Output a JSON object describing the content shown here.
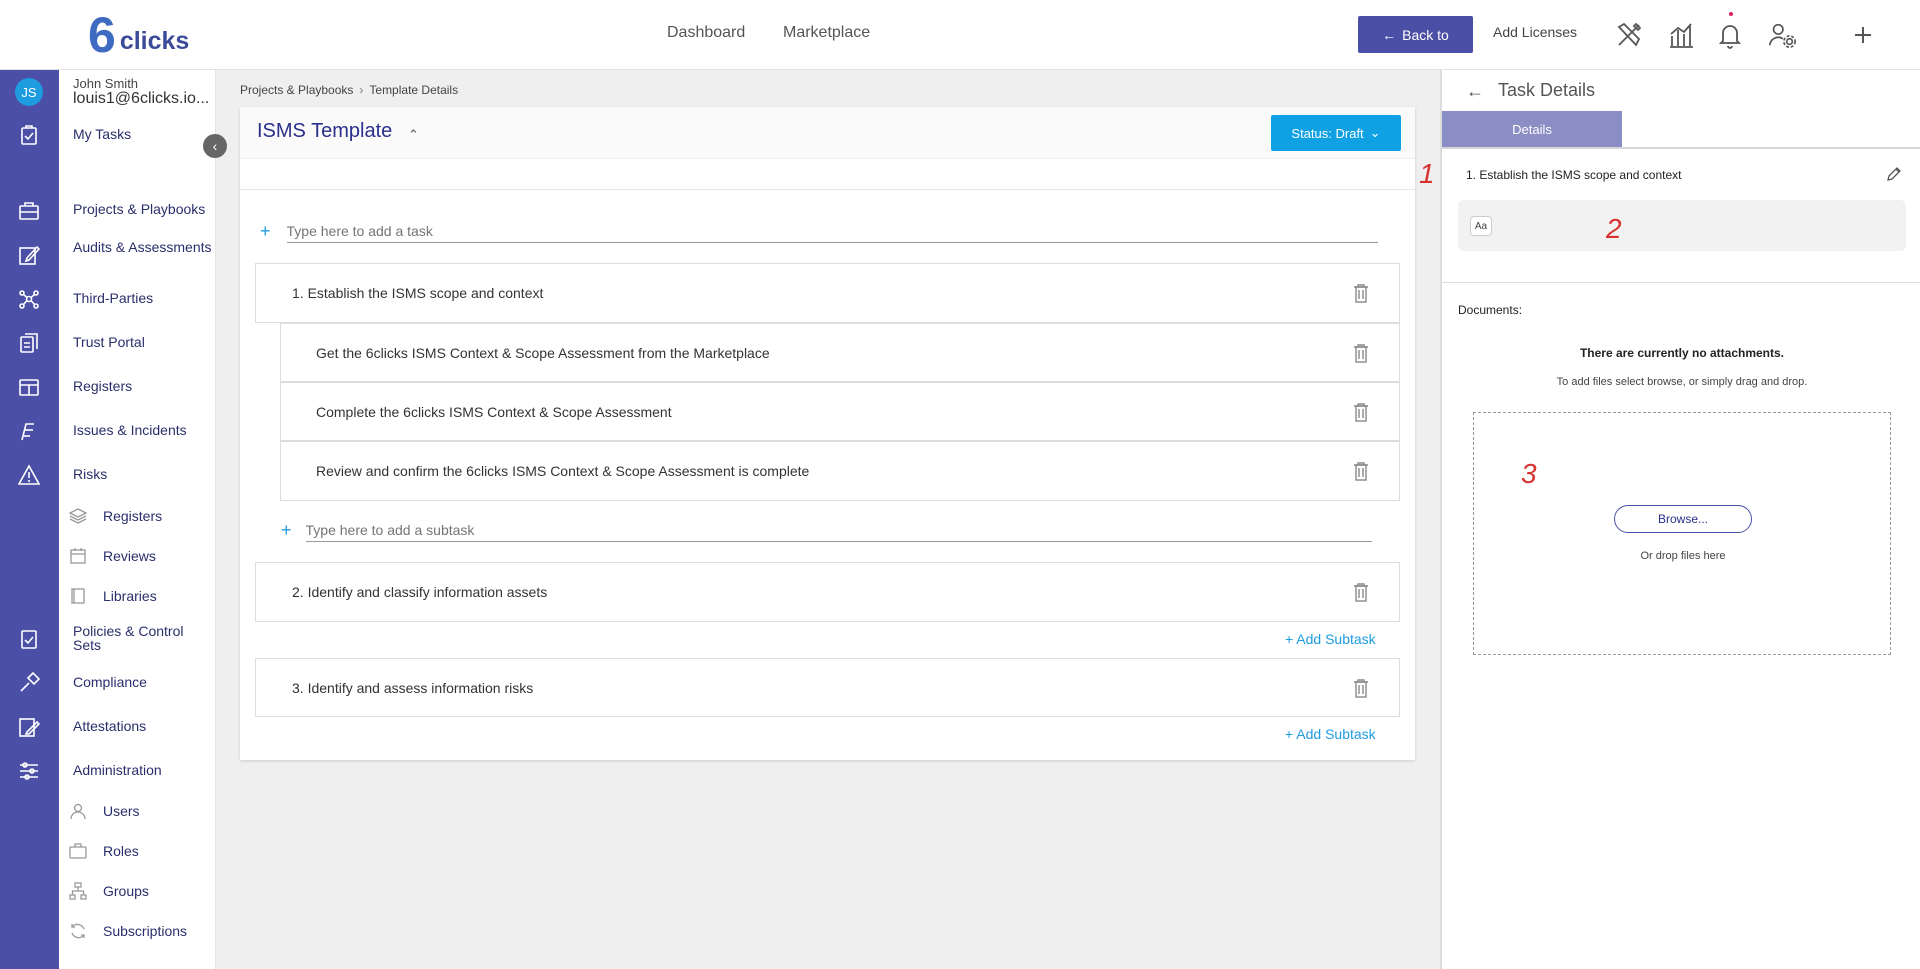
{
  "topbar": {
    "logo_mark": "6",
    "logo_text": "clicks",
    "nav": [
      "Dashboard",
      "Marketplace"
    ],
    "back_label": "Back to",
    "add_licenses": "Add Licenses"
  },
  "user": {
    "initials": "JS",
    "name": "John Smith",
    "email": "louis1@6clicks.io..."
  },
  "sidebar": {
    "my_tasks": "My Tasks",
    "items": [
      "Projects & Playbooks",
      "Audits & Assessments",
      "Third-Parties",
      "Trust Portal",
      "Registers",
      "Issues & Incidents",
      "Risks"
    ],
    "risks_sub": [
      "Registers",
      "Reviews",
      "Libraries"
    ],
    "items2": [
      "Policies & Control Sets",
      "Compliance",
      "Attestations",
      "Administration"
    ],
    "admin_sub": [
      "Users",
      "Roles",
      "Groups",
      "Subscriptions"
    ]
  },
  "breadcrumb": [
    "Projects & Playbooks",
    "Template Details"
  ],
  "template": {
    "title": "ISMS Template",
    "status_label": "Status: Draft",
    "add_task_placeholder": "Type here to add a task",
    "add_subtask_placeholder": "Type here to add a subtask",
    "add_subtask_label": "+ Add Subtask",
    "tasks": [
      {
        "label": "1. Establish the ISMS scope and context",
        "subtasks": [
          "Get the 6clicks ISMS Context & Scope Assessment from the Marketplace",
          "Complete the 6clicks ISMS Context & Scope Assessment",
          "Review and confirm the 6clicks ISMS Context & Scope Assessment is complete"
        ]
      },
      {
        "label": "2. Identify and classify information assets"
      },
      {
        "label": "3. Identify and assess information risks"
      }
    ]
  },
  "task_details": {
    "title": "Task Details",
    "tab": "Details",
    "task_name": "1. Establish the ISMS scope and context",
    "aa_label": "Aa",
    "documents_label": "Documents:",
    "no_attachments": "There are currently no attachments.",
    "hint": "To add files select browse, or simply drag and drop.",
    "browse": "Browse...",
    "drop_text": "Or drop files here"
  },
  "annotations": [
    "1",
    "2",
    "3"
  ],
  "colors": {
    "rail": "#4b4fa6",
    "accent": "#10a1e4",
    "link": "#1e9ce0",
    "annotation": "#d8322f"
  }
}
